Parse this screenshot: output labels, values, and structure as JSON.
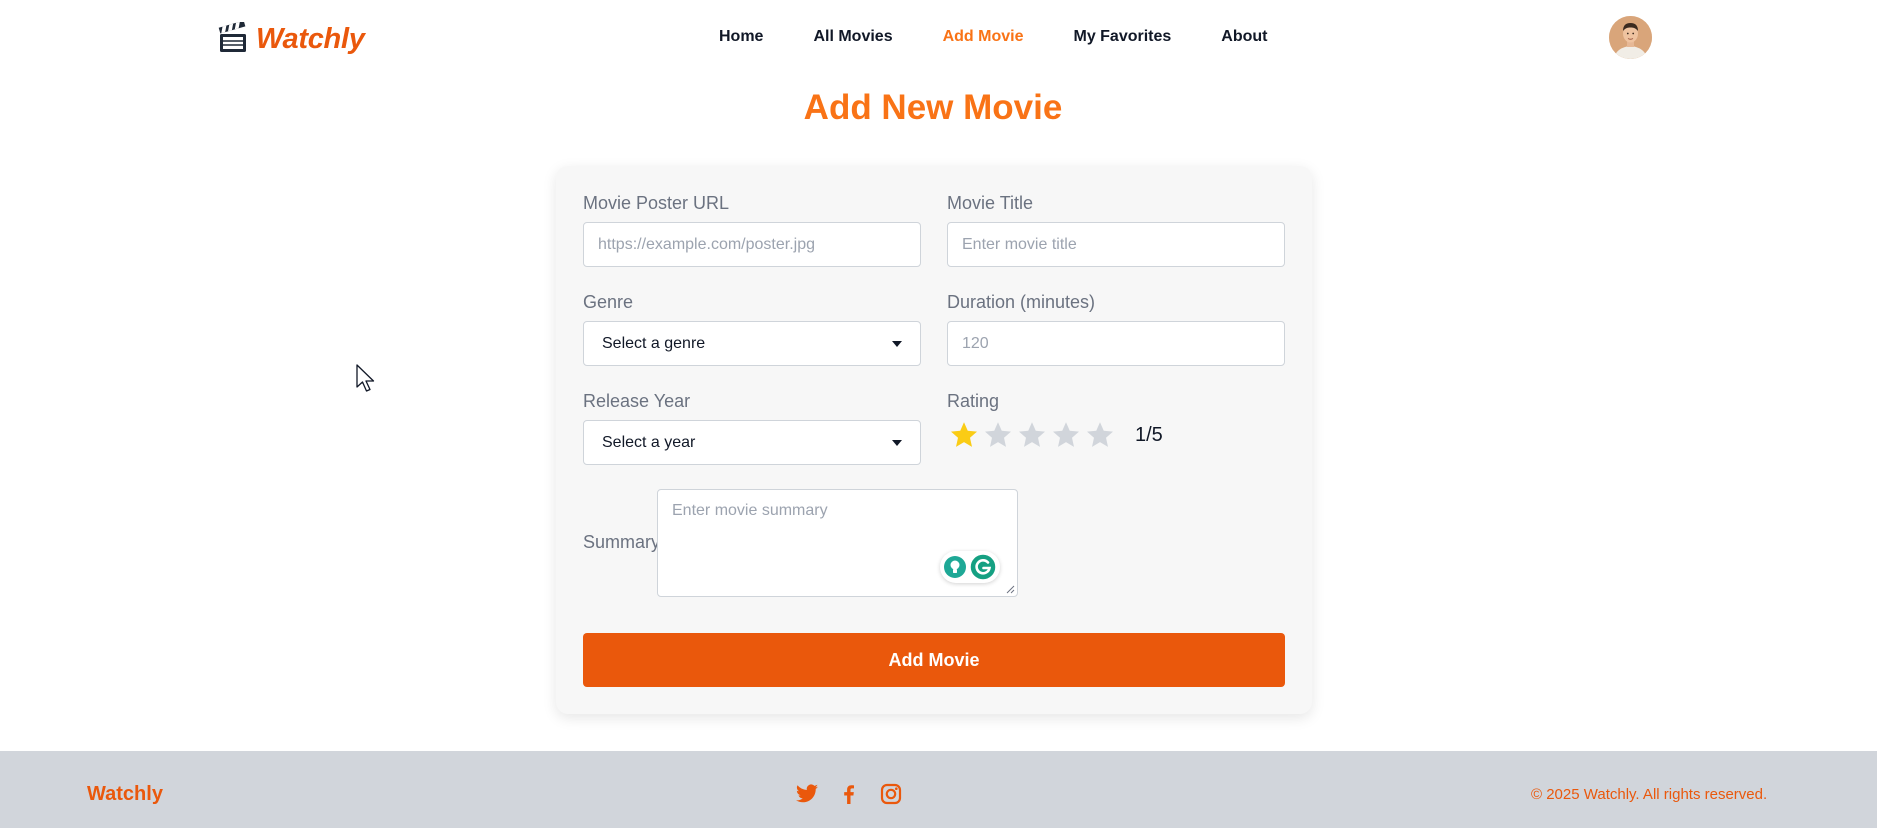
{
  "brand": {
    "name": "Watchly",
    "logo_icon": "clapperboard-icon",
    "accent_color": "#ea580c"
  },
  "nav": {
    "items": [
      {
        "label": "Home",
        "active": false
      },
      {
        "label": "All Movies",
        "active": false
      },
      {
        "label": "Add Movie",
        "active": true
      },
      {
        "label": "My Favorites",
        "active": false
      },
      {
        "label": "About",
        "active": false
      }
    ],
    "avatar_icon": "user-avatar"
  },
  "page": {
    "title": "Add New Movie"
  },
  "form": {
    "poster": {
      "label": "Movie Poster URL",
      "value": "",
      "placeholder": "https://example.com/poster.jpg"
    },
    "title": {
      "label": "Movie Title",
      "value": "",
      "placeholder": "Enter movie title"
    },
    "genre": {
      "label": "Genre",
      "selected": "Select a genre"
    },
    "duration": {
      "label": "Duration (minutes)",
      "value": "",
      "placeholder": "120"
    },
    "year": {
      "label": "Release Year",
      "selected": "Select a year"
    },
    "rating": {
      "label": "Rating",
      "value": 1,
      "max": 5,
      "display": "1/5",
      "filled_color": "#facc15",
      "empty_color": "#d1d5db"
    },
    "summary": {
      "label": "Summary",
      "value": "",
      "placeholder": "Enter movie summary"
    },
    "submit_label": "Add Movie"
  },
  "footer": {
    "brand": "Watchly",
    "social_icons": [
      "twitter-icon",
      "facebook-icon",
      "instagram-icon"
    ],
    "copyright": "© 2025 Watchly. All rights reserved."
  }
}
